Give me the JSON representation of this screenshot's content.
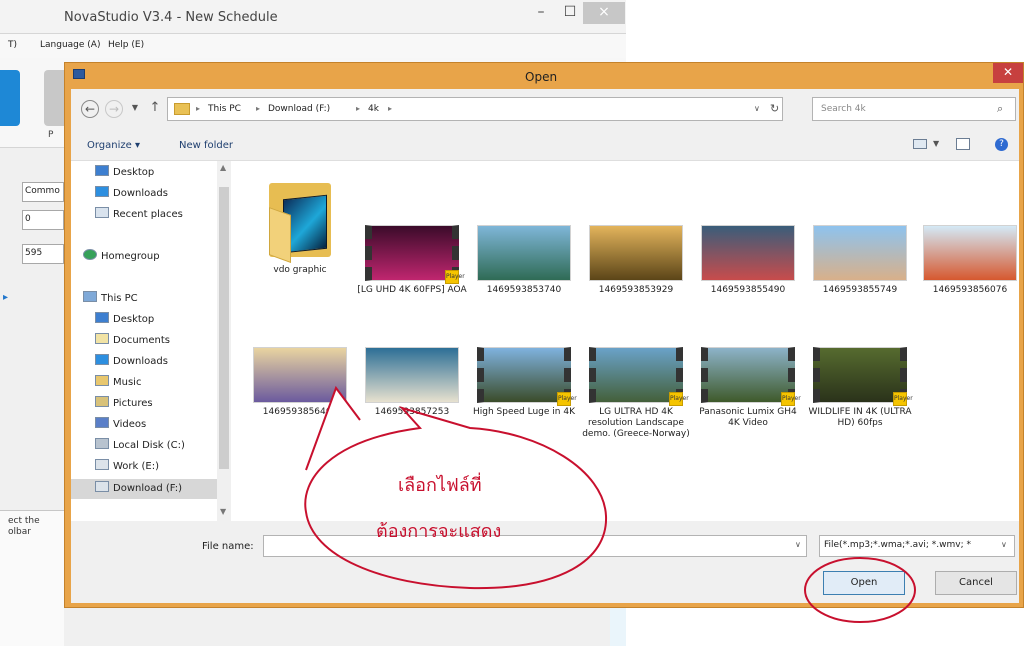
{
  "background_app": {
    "title": "NovaStudio V3.4 - New Schedule",
    "menus": [
      "T)",
      "Language (A)",
      "Help (E)"
    ],
    "toolbar_label": "P",
    "fields": [
      "Commo",
      "0",
      "595"
    ],
    "note": "ect the\nolbar"
  },
  "dialog": {
    "title": "Open",
    "breadcrumbs": [
      "This PC",
      "Download (F:)",
      "4k"
    ],
    "search_placeholder": "Search 4k",
    "commands": {
      "organize": "Organize ▾",
      "new_folder": "New folder"
    },
    "nav_items": [
      {
        "label": "Desktop",
        "icon": "desktop-icon"
      },
      {
        "label": "Downloads",
        "icon": "downloads-icon"
      },
      {
        "label": "Recent places",
        "icon": "recent-places-icon"
      },
      {
        "label": "Homegroup",
        "icon": "homegroup-icon"
      },
      {
        "label": "This PC",
        "icon": "this-pc-icon"
      },
      {
        "label": "Desktop",
        "icon": "desktop-icon"
      },
      {
        "label": "Documents",
        "icon": "documents-icon"
      },
      {
        "label": "Downloads",
        "icon": "downloads-icon"
      },
      {
        "label": "Music",
        "icon": "music-icon"
      },
      {
        "label": "Pictures",
        "icon": "pictures-icon"
      },
      {
        "label": "Videos",
        "icon": "videos-icon"
      },
      {
        "label": "Local Disk (C:)",
        "icon": "local-disk-icon"
      },
      {
        "label": "Work (E:)",
        "icon": "drive-icon"
      },
      {
        "label": "Download (F:)",
        "icon": "drive-icon"
      }
    ],
    "files": [
      {
        "name": "vdo graphic",
        "kind": "folder"
      },
      {
        "name": "[LG UHD 4K 60FPS] AOA",
        "kind": "video",
        "colors": [
          "#3b0b2a",
          "#c0266f"
        ]
      },
      {
        "name": "1469593853740",
        "kind": "image",
        "colors": [
          "#7fb6d8",
          "#2f6b55"
        ]
      },
      {
        "name": "1469593853929",
        "kind": "image",
        "colors": [
          "#e3b45c",
          "#5b4518"
        ]
      },
      {
        "name": "1469593855490",
        "kind": "image",
        "colors": [
          "#3a5d7a",
          "#c84c4c"
        ]
      },
      {
        "name": "1469593855749",
        "kind": "image",
        "colors": [
          "#8ec3ee",
          "#d8b08a"
        ]
      },
      {
        "name": "1469593856076",
        "kind": "image",
        "colors": [
          "#d4e9f6",
          "#d6582f"
        ]
      },
      {
        "name": "1469593856460",
        "kind": "image",
        "colors": [
          "#e9d4a0",
          "#6b5a9e"
        ]
      },
      {
        "name": "1469593857253",
        "kind": "image",
        "colors": [
          "#2d6f96",
          "#e7e1cf"
        ]
      },
      {
        "name": "High Speed Luge in 4K",
        "kind": "video",
        "colors": [
          "#7fb2de",
          "#3b4c2a"
        ]
      },
      {
        "name": "LG ULTRA HD 4K resolution Landscape demo. (Greece-Norway)",
        "kind": "video",
        "colors": [
          "#6aa2c8",
          "#44603a"
        ]
      },
      {
        "name": "Panasonic Lumix GH4 4K Video",
        "kind": "video",
        "colors": [
          "#8db3c9",
          "#3f5a2b"
        ]
      },
      {
        "name": "WILDLIFE IN 4K (ULTRA HD) 60fps",
        "kind": "video",
        "colors": [
          "#566b2f",
          "#2a321a"
        ]
      }
    ],
    "file_name_label": "File name:",
    "file_name_value": "",
    "file_type": "File(*.mp3;*.wma;*.avi; *.wmv; *",
    "open_label": "Open",
    "cancel_label": "Cancel",
    "player_badge": "Player"
  },
  "annotation": {
    "line1": "เลือกไฟล์ที่",
    "line2": "ต้องการจะแสดง",
    "color": "#c8102e"
  }
}
